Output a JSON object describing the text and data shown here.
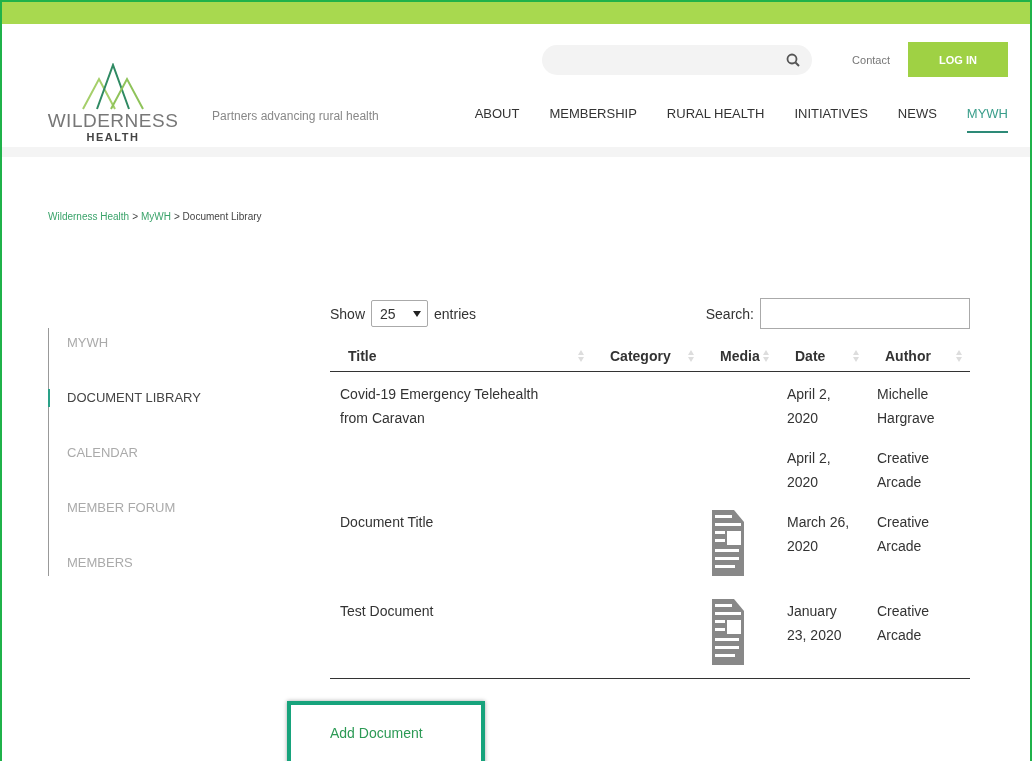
{
  "header": {
    "logo": {
      "name": "WILDERNESS",
      "subtitle": "HEALTH"
    },
    "tagline": "Partners advancing rural health",
    "contact": "Contact",
    "login": "LOG IN",
    "nav": [
      {
        "label": "ABOUT",
        "selected": false
      },
      {
        "label": "MEMBERSHIP",
        "selected": false
      },
      {
        "label": "RURAL HEALTH",
        "selected": false
      },
      {
        "label": "INITIATIVES",
        "selected": false
      },
      {
        "label": "NEWS",
        "selected": false
      },
      {
        "label": "MYWH",
        "selected": true
      }
    ]
  },
  "breadcrumb": [
    {
      "label": "Wilderness Health",
      "kind": "link"
    },
    {
      "label": ">",
      "kind": "separator"
    },
    {
      "label": "MyWH",
      "kind": "link"
    },
    {
      "label": "> Document Library",
      "kind": "current"
    }
  ],
  "sidebar": {
    "items": [
      {
        "label": "MYWH",
        "selected": false
      },
      {
        "label": "DOCUMENT LIBRARY",
        "selected": true
      },
      {
        "label": "CALENDAR",
        "selected": false
      },
      {
        "label": "MEMBER FORUM",
        "selected": false
      },
      {
        "label": "MEMBERS",
        "selected": false
      }
    ]
  },
  "table": {
    "show_label": "Show",
    "page_size": "25",
    "entries_label": "entries",
    "search_label": "Search:",
    "columns": [
      "Title",
      "Category",
      "Media",
      "Date",
      "Author"
    ],
    "rows": [
      {
        "title": "Covid-19 Emergency Telehealth from Caravan",
        "has_media": false,
        "date": "April 2, 2020",
        "author": "Michelle Hargrave"
      },
      {
        "has_media": false,
        "date": "April 2, 2020",
        "author": "Creative Arcade"
      },
      {
        "title": "Document Title",
        "has_media": true,
        "date": "March 26, 2020",
        "author": "Creative Arcade"
      },
      {
        "title": "Test Document",
        "has_media": true,
        "date": "January 23, 2020",
        "author": "Creative Arcade"
      }
    ]
  },
  "add_document": {
    "label": "Add Document",
    "highlighted": true
  }
}
